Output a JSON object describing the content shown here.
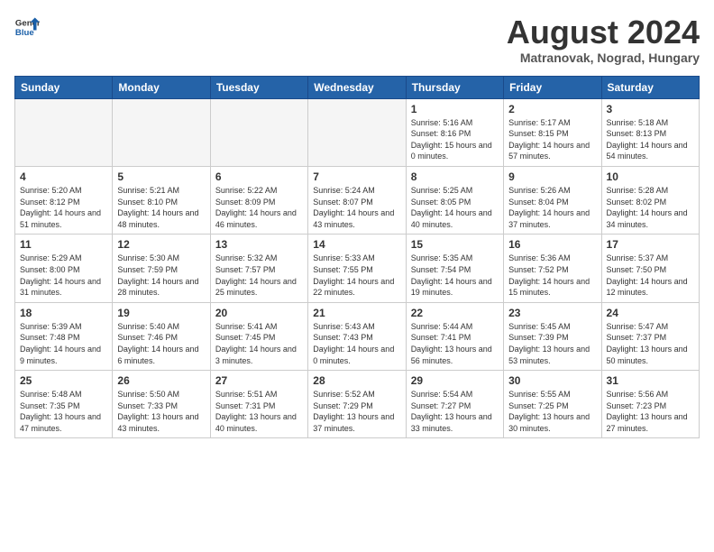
{
  "logo": {
    "general": "General",
    "blue": "Blue"
  },
  "title": "August 2024",
  "subtitle": "Matranovak, Nograd, Hungary",
  "days_of_week": [
    "Sunday",
    "Monday",
    "Tuesday",
    "Wednesday",
    "Thursday",
    "Friday",
    "Saturday"
  ],
  "weeks": [
    [
      {
        "day": "",
        "info": ""
      },
      {
        "day": "",
        "info": ""
      },
      {
        "day": "",
        "info": ""
      },
      {
        "day": "",
        "info": ""
      },
      {
        "day": "1",
        "info": "Sunrise: 5:16 AM\nSunset: 8:16 PM\nDaylight: 15 hours\nand 0 minutes."
      },
      {
        "day": "2",
        "info": "Sunrise: 5:17 AM\nSunset: 8:15 PM\nDaylight: 14 hours\nand 57 minutes."
      },
      {
        "day": "3",
        "info": "Sunrise: 5:18 AM\nSunset: 8:13 PM\nDaylight: 14 hours\nand 54 minutes."
      }
    ],
    [
      {
        "day": "4",
        "info": "Sunrise: 5:20 AM\nSunset: 8:12 PM\nDaylight: 14 hours\nand 51 minutes."
      },
      {
        "day": "5",
        "info": "Sunrise: 5:21 AM\nSunset: 8:10 PM\nDaylight: 14 hours\nand 48 minutes."
      },
      {
        "day": "6",
        "info": "Sunrise: 5:22 AM\nSunset: 8:09 PM\nDaylight: 14 hours\nand 46 minutes."
      },
      {
        "day": "7",
        "info": "Sunrise: 5:24 AM\nSunset: 8:07 PM\nDaylight: 14 hours\nand 43 minutes."
      },
      {
        "day": "8",
        "info": "Sunrise: 5:25 AM\nSunset: 8:05 PM\nDaylight: 14 hours\nand 40 minutes."
      },
      {
        "day": "9",
        "info": "Sunrise: 5:26 AM\nSunset: 8:04 PM\nDaylight: 14 hours\nand 37 minutes."
      },
      {
        "day": "10",
        "info": "Sunrise: 5:28 AM\nSunset: 8:02 PM\nDaylight: 14 hours\nand 34 minutes."
      }
    ],
    [
      {
        "day": "11",
        "info": "Sunrise: 5:29 AM\nSunset: 8:00 PM\nDaylight: 14 hours\nand 31 minutes."
      },
      {
        "day": "12",
        "info": "Sunrise: 5:30 AM\nSunset: 7:59 PM\nDaylight: 14 hours\nand 28 minutes."
      },
      {
        "day": "13",
        "info": "Sunrise: 5:32 AM\nSunset: 7:57 PM\nDaylight: 14 hours\nand 25 minutes."
      },
      {
        "day": "14",
        "info": "Sunrise: 5:33 AM\nSunset: 7:55 PM\nDaylight: 14 hours\nand 22 minutes."
      },
      {
        "day": "15",
        "info": "Sunrise: 5:35 AM\nSunset: 7:54 PM\nDaylight: 14 hours\nand 19 minutes."
      },
      {
        "day": "16",
        "info": "Sunrise: 5:36 AM\nSunset: 7:52 PM\nDaylight: 14 hours\nand 15 minutes."
      },
      {
        "day": "17",
        "info": "Sunrise: 5:37 AM\nSunset: 7:50 PM\nDaylight: 14 hours\nand 12 minutes."
      }
    ],
    [
      {
        "day": "18",
        "info": "Sunrise: 5:39 AM\nSunset: 7:48 PM\nDaylight: 14 hours\nand 9 minutes."
      },
      {
        "day": "19",
        "info": "Sunrise: 5:40 AM\nSunset: 7:46 PM\nDaylight: 14 hours\nand 6 minutes."
      },
      {
        "day": "20",
        "info": "Sunrise: 5:41 AM\nSunset: 7:45 PM\nDaylight: 14 hours\nand 3 minutes."
      },
      {
        "day": "21",
        "info": "Sunrise: 5:43 AM\nSunset: 7:43 PM\nDaylight: 14 hours\nand 0 minutes."
      },
      {
        "day": "22",
        "info": "Sunrise: 5:44 AM\nSunset: 7:41 PM\nDaylight: 13 hours\nand 56 minutes."
      },
      {
        "day": "23",
        "info": "Sunrise: 5:45 AM\nSunset: 7:39 PM\nDaylight: 13 hours\nand 53 minutes."
      },
      {
        "day": "24",
        "info": "Sunrise: 5:47 AM\nSunset: 7:37 PM\nDaylight: 13 hours\nand 50 minutes."
      }
    ],
    [
      {
        "day": "25",
        "info": "Sunrise: 5:48 AM\nSunset: 7:35 PM\nDaylight: 13 hours\nand 47 minutes."
      },
      {
        "day": "26",
        "info": "Sunrise: 5:50 AM\nSunset: 7:33 PM\nDaylight: 13 hours\nand 43 minutes."
      },
      {
        "day": "27",
        "info": "Sunrise: 5:51 AM\nSunset: 7:31 PM\nDaylight: 13 hours\nand 40 minutes."
      },
      {
        "day": "28",
        "info": "Sunrise: 5:52 AM\nSunset: 7:29 PM\nDaylight: 13 hours\nand 37 minutes."
      },
      {
        "day": "29",
        "info": "Sunrise: 5:54 AM\nSunset: 7:27 PM\nDaylight: 13 hours\nand 33 minutes."
      },
      {
        "day": "30",
        "info": "Sunrise: 5:55 AM\nSunset: 7:25 PM\nDaylight: 13 hours\nand 30 minutes."
      },
      {
        "day": "31",
        "info": "Sunrise: 5:56 AM\nSunset: 7:23 PM\nDaylight: 13 hours\nand 27 minutes."
      }
    ]
  ]
}
